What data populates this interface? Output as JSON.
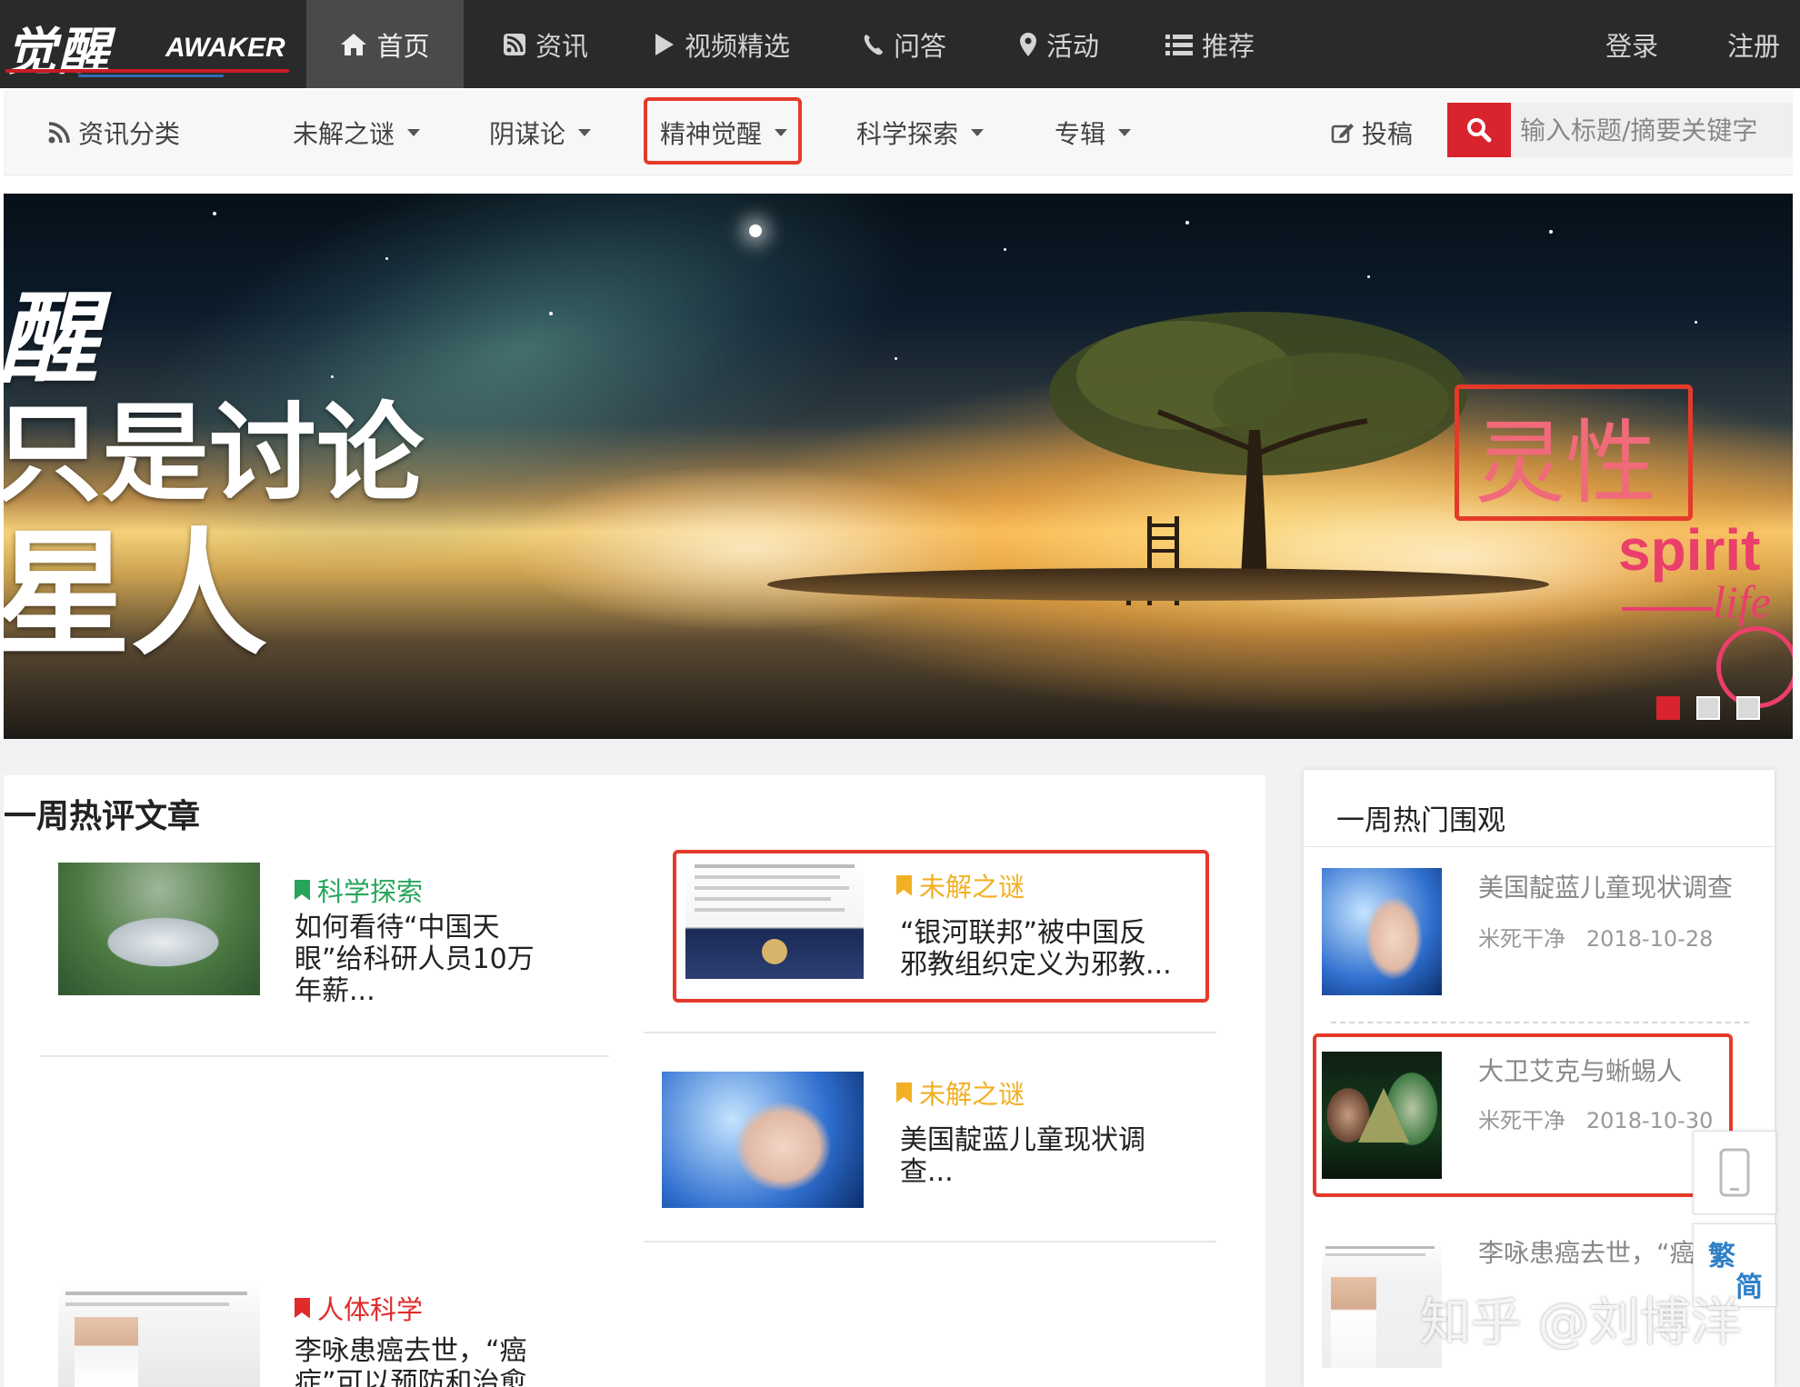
{
  "logo": {
    "cn": "觉醒",
    "en": "AWAKER"
  },
  "topnav": {
    "items": [
      {
        "label": "首页",
        "icon": "home-icon"
      },
      {
        "label": "资讯",
        "icon": "rss-icon"
      },
      {
        "label": "视频精选",
        "icon": "play-icon"
      },
      {
        "label": "问答",
        "icon": "phone-icon"
      },
      {
        "label": "活动",
        "icon": "map-pin-icon"
      },
      {
        "label": "推荐",
        "icon": "list-icon"
      }
    ],
    "login": "登录",
    "register": "注册"
  },
  "subnav": {
    "category_label": "资讯分类",
    "items": [
      {
        "label": "未解之谜"
      },
      {
        "label": "阴谋论"
      },
      {
        "label": "精神觉醒"
      },
      {
        "label": "科学探索"
      },
      {
        "label": "专辑"
      }
    ],
    "submit": "投稿",
    "search_placeholder": "输入标题/摘要关键字"
  },
  "banner": {
    "left_line1": "醒",
    "left_line2": "只是讨论",
    "left_line3": "星人",
    "spirit_cn": "灵性",
    "spirit_en": "spirit",
    "spirit_life": "life",
    "active_slide": 1,
    "slide_count": 3
  },
  "hot_comment": {
    "title": "一周热评文章",
    "articles": [
      {
        "category": "科学探索",
        "title_l1": "如何看待“中国天",
        "title_l2": "眼”给科研人员10万",
        "title_l3": "年薪...",
        "category_color": "#26a65b"
      },
      {
        "category": "未解之谜",
        "title_l1": "“银河联邦”被中国反",
        "title_l2": "邪教组织定义为邪教...",
        "category_color": "#f2b024"
      },
      {
        "category": "未解之谜",
        "title_l1": "美国靛蓝儿童现状调",
        "title_l2": "查...",
        "category_color": "#f2b024"
      },
      {
        "category": "人体科学",
        "title_l1": "李咏患癌去世，“癌",
        "title_l2": "症”可以预防和治愈",
        "category_color": "#e02b2b"
      }
    ]
  },
  "hot_view": {
    "title": "一周热门围观",
    "items": [
      {
        "title": "美国靛蓝儿童现状调查",
        "author": "米死干净",
        "date": "2018-10-28"
      },
      {
        "title": "大卫艾克与蜥蜴人",
        "author": "米死干净",
        "date": "2018-10-30"
      },
      {
        "title": "李咏患癌去世，“癌",
        "author": "",
        "date": ""
      }
    ]
  },
  "float": {
    "trad": "繁",
    "simp": "简"
  },
  "watermark": "知乎 @刘博洋"
}
